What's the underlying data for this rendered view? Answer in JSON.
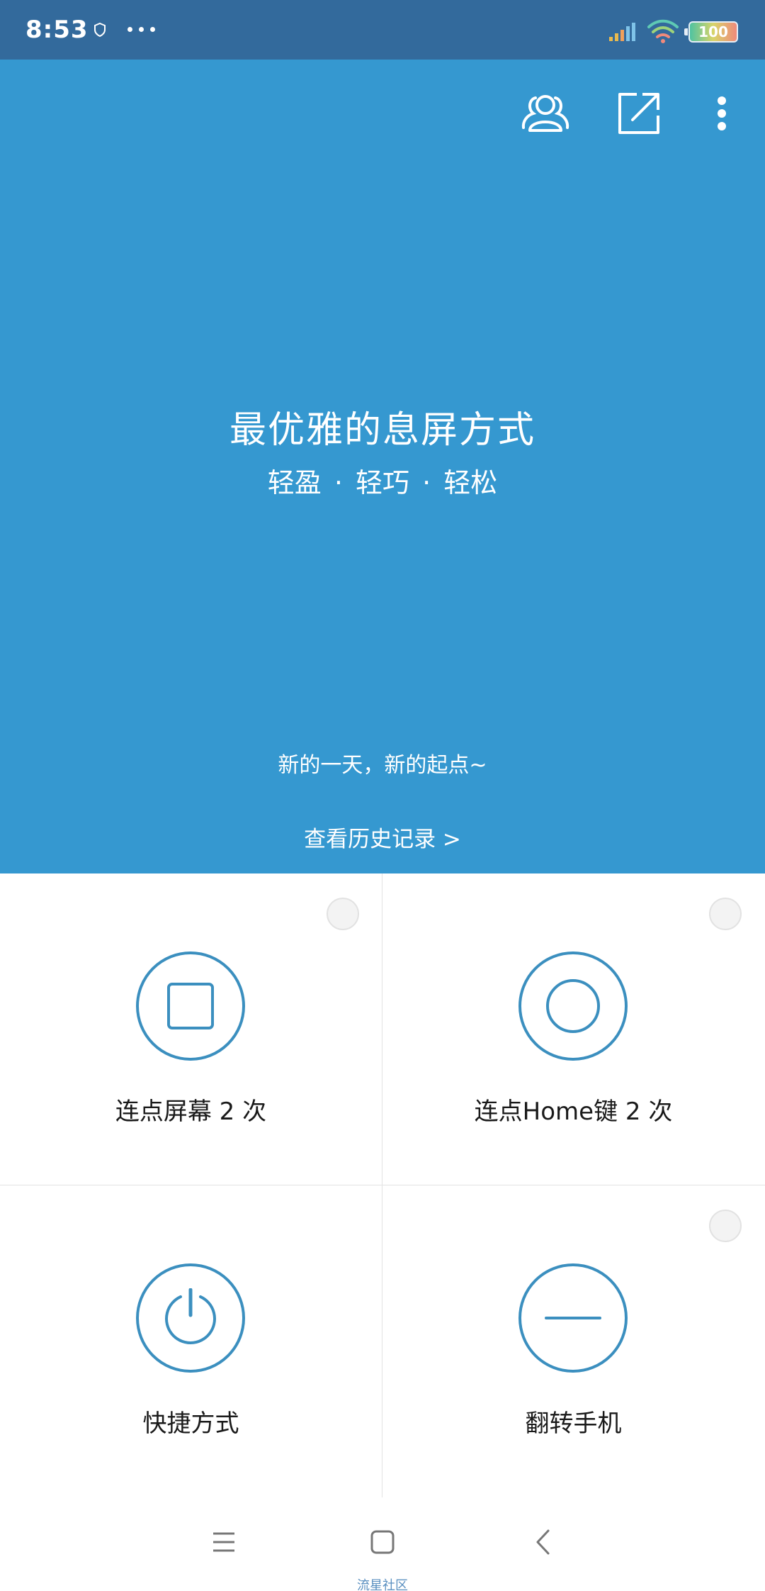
{
  "status_bar": {
    "time": "8:53",
    "battery": "100",
    "icons": [
      "shield-icon",
      "more-dots-icon",
      "signal-icon",
      "wifi-icon",
      "battery-icon"
    ]
  },
  "header": {
    "actions": [
      "users-icon",
      "open-external-icon",
      "more-vertical-icon"
    ]
  },
  "hero": {
    "title": "最优雅的息屏方式",
    "subtitle": "轻盈 · 轻巧 · 轻松",
    "greeting": "新的一天，新的起点~",
    "history_link": "查看历史记录 >"
  },
  "options": [
    {
      "label": "连点屏幕 2 次",
      "icon": "square-icon",
      "toggle": true
    },
    {
      "label": "连点Home键 2 次",
      "icon": "circle-icon",
      "toggle": true
    },
    {
      "label": "快捷方式",
      "icon": "power-icon",
      "toggle": false
    },
    {
      "label": "翻转手机",
      "icon": "minus-icon",
      "toggle": true
    }
  ],
  "nav": {
    "buttons": [
      "menu-icon",
      "home-icon",
      "back-icon"
    ],
    "watermark": "流星社区"
  },
  "colors": {
    "status_bar": "#336a9c",
    "hero_bg": "#3598d0",
    "accent": "#3b8fbf"
  }
}
